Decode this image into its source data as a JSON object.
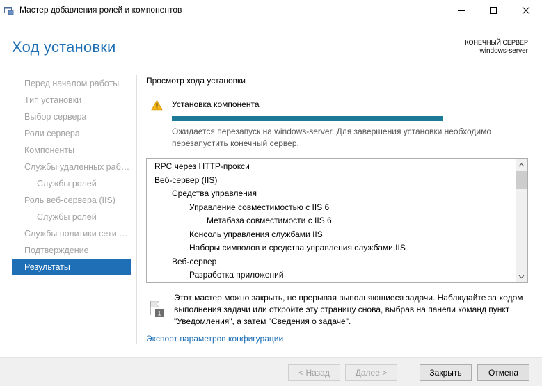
{
  "window": {
    "title": "Мастер добавления ролей и компонентов"
  },
  "header": {
    "page_title": "Ход установки",
    "destination_label": "КОНЕЧНЫЙ СЕРВЕР",
    "destination_value": "windows-server"
  },
  "nav": {
    "items": [
      {
        "label": "Перед началом работы"
      },
      {
        "label": "Тип установки"
      },
      {
        "label": "Выбор сервера"
      },
      {
        "label": "Роли сервера"
      },
      {
        "label": "Компоненты"
      },
      {
        "label": "Службы удаленных рабо..."
      },
      {
        "label": "Службы ролей"
      },
      {
        "label": "Роль веб-сервера (IIS)"
      },
      {
        "label": "Службы ролей"
      },
      {
        "label": "Службы политики сети и..."
      },
      {
        "label": "Подтверждение"
      },
      {
        "label": "Результаты"
      }
    ]
  },
  "main": {
    "section_title": "Просмотр хода установки",
    "status": "Установка компонента",
    "progress": 1.0,
    "note_line_1": "Ожидается перезапуск на windows-server. Для завершения установки необходимо",
    "note_line_2": "перезапустить конечный сервер.",
    "results": [
      {
        "label": "RPC через HTTP-прокси",
        "level": 0
      },
      {
        "label": "Веб-сервер (IIS)",
        "level": 0
      },
      {
        "label": "Средства управления",
        "level": 1
      },
      {
        "label": "Управление совместимостью с IIS 6",
        "level": 2
      },
      {
        "label": "Метабаза совместимости с IIS 6",
        "level": 3
      },
      {
        "label": "Консоль управления службами IIS",
        "level": 2
      },
      {
        "label": "Наборы символов и средства управления службами IIS",
        "level": 2
      },
      {
        "label": "Веб-сервер",
        "level": 1
      },
      {
        "label": "Разработка приложений",
        "level": 2
      }
    ],
    "info_line_1": "Этот мастер можно закрыть, не прерывая выполняющиеся задачи. Наблюдайте за ходом",
    "info_line_2": "выполнения задачи или откройте эту страницу снова, выбрав на панели команд пункт",
    "info_line_3": "\"Уведомления\", а затем \"Сведения о задаче\".",
    "flag_badge": "1",
    "export_link": "Экспорт параметров конфигурации"
  },
  "footer": {
    "back_label": "< Назад",
    "next_label": "Далее >",
    "close_label": "Закрыть",
    "cancel_label": "Отмена"
  },
  "colors": {
    "accent": "#1e6fb5",
    "progress": "#1c7a96",
    "warning": "#f2b418"
  }
}
